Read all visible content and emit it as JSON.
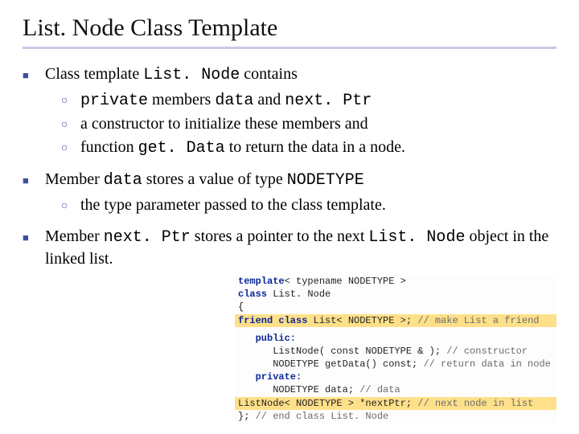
{
  "title": "List. Node Class Template",
  "bullets": {
    "b1": {
      "pre": "Class template ",
      "code": "List. Node",
      "post": " contains"
    },
    "b1a": {
      "code1": "private",
      "mid1": " members ",
      "code2": "data",
      "mid2": " and ",
      "code3": "next. Ptr"
    },
    "b1b": "a constructor to initialize these members and",
    "b1c": {
      "pre": "function ",
      "code": "get. Data",
      "post": " to return the data in a node."
    },
    "b2": {
      "pre": "Member ",
      "code1": "data",
      "mid": " stores a value of type ",
      "code2": "NODETYPE"
    },
    "b2a": "the type parameter passed to the class template.",
    "b3": {
      "pre": "Member ",
      "code1": "next. Ptr",
      "mid": " stores a pointer to the next ",
      "code2": "List. Node",
      "post": " object in the linked list."
    }
  },
  "code": {
    "l1_kw": "template",
    "l1_rest": "< typename NODETYPE >",
    "l2_kw": "class",
    "l2_rest": " List. Node",
    "l3": "{",
    "l4_kw": "   friend class",
    "l4_rest": " List< NODETYPE >; ",
    "l4_cm": "// make List a friend",
    "l5_kw": "   public:",
    "l6": "      ListNode( const NODETYPE & ); ",
    "l6_cm": "// constructor",
    "l7": "      NODETYPE getData() const; ",
    "l7_cm": "// return data in node",
    "l8_kw": "   private:",
    "l9": "      NODETYPE data; ",
    "l9_cm": "// data",
    "l10": "      ListNode< NODETYPE > *nextPtr; ",
    "l10_cm": "// next node in list",
    "l11": "}; ",
    "l11_cm": "// end class List. Node"
  }
}
